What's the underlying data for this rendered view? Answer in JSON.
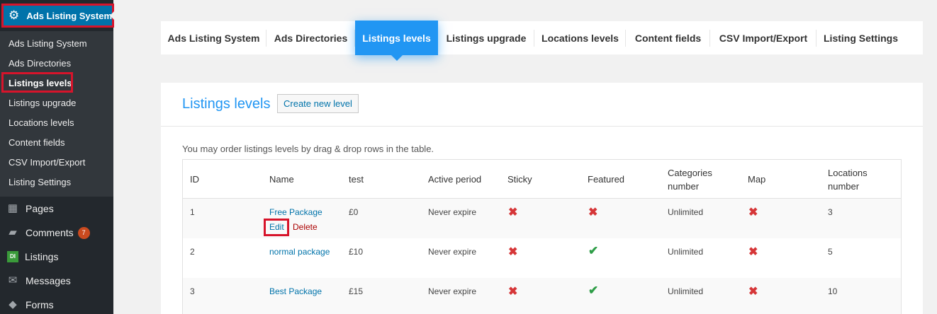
{
  "sidebar": {
    "active_menu": {
      "label": "Ads Listing System",
      "icon": "gear-icon"
    },
    "submenu": [
      {
        "label": "Ads Listing System"
      },
      {
        "label": "Ads Directories"
      },
      {
        "label": "Listings levels"
      },
      {
        "label": "Listings upgrade"
      },
      {
        "label": "Locations levels"
      },
      {
        "label": "Content fields"
      },
      {
        "label": "CSV Import/Export"
      },
      {
        "label": "Listing Settings"
      }
    ],
    "menu": [
      {
        "label": "Pages",
        "icon": "pages-icon"
      },
      {
        "label": "Comments",
        "icon": "comments-icon",
        "badge": "7"
      },
      {
        "label": "Listings",
        "icon": "listings-icon",
        "icon_text": "DI"
      },
      {
        "label": "Messages",
        "icon": "messages-icon"
      },
      {
        "label": "Forms",
        "icon": "forms-icon"
      }
    ]
  },
  "tabs": [
    {
      "label": "Ads Listing System"
    },
    {
      "label": "Ads Directories"
    },
    {
      "label": "Listings levels"
    },
    {
      "label": "Listings upgrade"
    },
    {
      "label": "Locations levels"
    },
    {
      "label": "Content fields"
    },
    {
      "label": "CSV Import/Export"
    },
    {
      "label": "Listing Settings"
    }
  ],
  "panel": {
    "title": "Listings levels",
    "create_button": "Create new level",
    "note": "You may order listings levels by drag & drop rows in the table."
  },
  "table": {
    "headers": {
      "id": "ID",
      "name": "Name",
      "test": "test",
      "active_period": "Active period",
      "sticky": "Sticky",
      "featured": "Featured",
      "categories_1": "Categories",
      "categories_2": "number",
      "map": "Map",
      "locations_1": "Locations",
      "locations_2": "number"
    },
    "row_actions": {
      "edit": "Edit",
      "delete": "Delete"
    },
    "rows": [
      {
        "id": "1",
        "name": "Free Package",
        "test": "£0",
        "active_period": "Never expire",
        "sticky": "no",
        "featured": "no",
        "categories": "Unlimited",
        "map": "no",
        "locations": "3"
      },
      {
        "id": "2",
        "name": "normal package",
        "test": "£10",
        "active_period": "Never expire",
        "sticky": "no",
        "featured": "yes",
        "categories": "Unlimited",
        "map": "no",
        "locations": "5"
      },
      {
        "id": "3",
        "name": "Best Package",
        "test": "£15",
        "active_period": "Never expire",
        "sticky": "no",
        "featured": "yes",
        "categories": "Unlimited",
        "map": "no",
        "locations": "10"
      }
    ]
  },
  "colors": {
    "accent": "#2196f3",
    "sidebar_bg": "#23282d",
    "highlight": "#d7142b",
    "cross": "#d63638",
    "check": "#2e9d47"
  }
}
